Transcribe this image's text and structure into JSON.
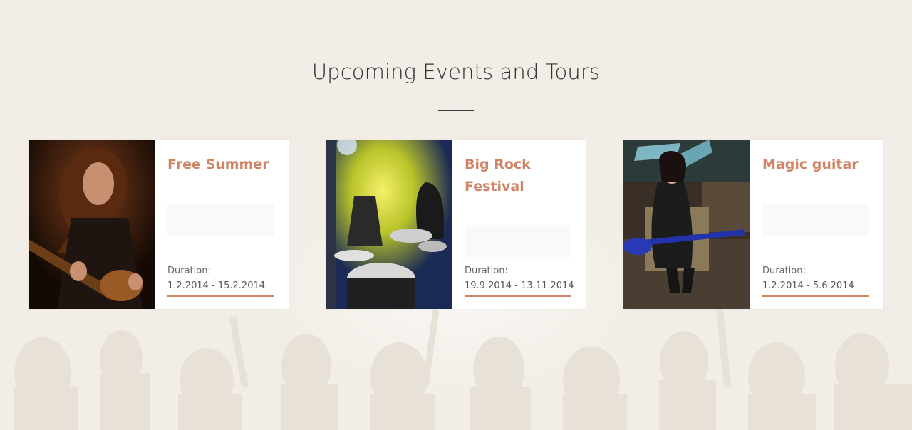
{
  "section": {
    "title": "Upcoming Events and Tours"
  },
  "events": [
    {
      "title": "Free Summer",
      "duration_label": "Duration:",
      "duration": "1.2.2014 - 15.2.2014",
      "image": "guitarist-photo"
    },
    {
      "title": "Big Rock Festival",
      "duration_label": "Duration:",
      "duration": "19.9.2014 - 13.11.2014",
      "image": "drummer-stage-photo"
    },
    {
      "title": "Magic guitar",
      "duration_label": "Duration:",
      "duration": "1.2.2014 - 5.6.2014",
      "image": "woman-guitar-photo"
    }
  ],
  "colors": {
    "background": "#f2eee7",
    "accent": "#cf8466",
    "heading": "#333333",
    "card": "#ffffff"
  }
}
